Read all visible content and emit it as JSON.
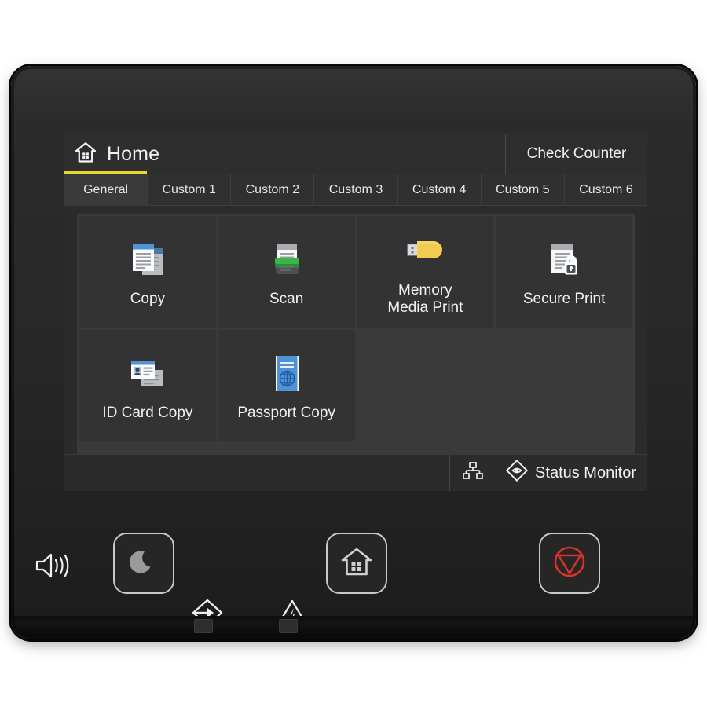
{
  "device": {
    "name": "multifunction-printer-control-panel"
  },
  "screen": {
    "header": {
      "home_icon": "home-icon",
      "title": "Home",
      "check_counter_label": "Check Counter"
    },
    "tabs": [
      {
        "label": "General",
        "active": true
      },
      {
        "label": "Custom 1",
        "active": false
      },
      {
        "label": "Custom 2",
        "active": false
      },
      {
        "label": "Custom 3",
        "active": false
      },
      {
        "label": "Custom 4",
        "active": false
      },
      {
        "label": "Custom 5",
        "active": false
      },
      {
        "label": "Custom 6",
        "active": false
      }
    ],
    "apps": [
      {
        "label": "Copy",
        "icon": "copy-documents-icon"
      },
      {
        "label": "Scan",
        "icon": "scanner-icon"
      },
      {
        "label": "Memory\nMedia Print",
        "icon": "usb-flash-drive-icon"
      },
      {
        "label": "Secure Print",
        "icon": "document-lock-icon"
      },
      {
        "label": "ID Card Copy",
        "icon": "id-card-icon"
      },
      {
        "label": "Passport Copy",
        "icon": "passport-icon"
      }
    ],
    "status_bar": {
      "network_icon": "network-icon",
      "status_monitor_icon": "eye-diamond-icon",
      "status_monitor_label": "Status Monitor"
    }
  },
  "hardware": {
    "volume_icon": "speaker-volume-icon",
    "sleep_button_icon": "crescent-moon-icon",
    "home_button_icon": "home-house-icon",
    "stop_button_icon": "stop-triangle-icon",
    "data_indicator_icon": "data-arrow-icon",
    "error_indicator_icon": "warning-triangle-icon"
  },
  "colors": {
    "accent_yellow": "#e8d52e",
    "stop_red": "#d8322c",
    "scan_green": "#2e9e46",
    "usb_yellow": "#f2cc4f",
    "passport_blue": "#4f92d8",
    "screen_bg": "#2b2b2b"
  }
}
